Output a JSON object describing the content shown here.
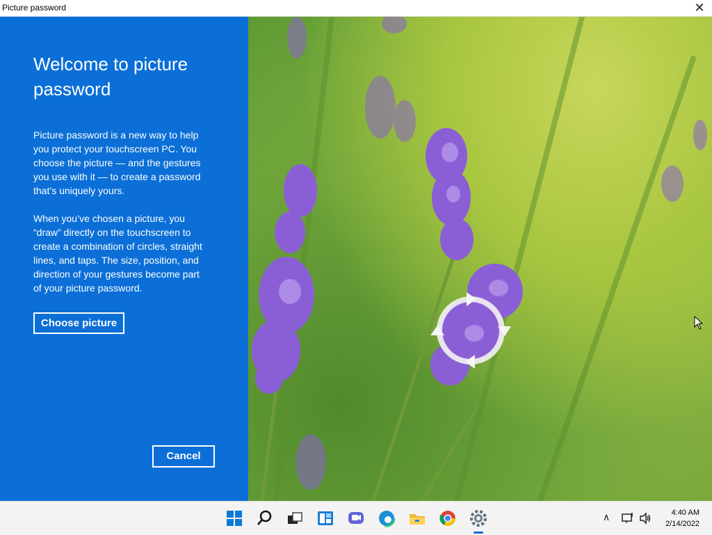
{
  "window": {
    "title": "Picture password",
    "close_label": "✕"
  },
  "panel": {
    "heading": "Welcome to picture password",
    "para1": "Picture password is a new way to help you protect your touchscreen PC. You choose the picture — and the gestures you use with it — to create a password that’s uniquely yours.",
    "para2": "When you’ve chosen a picture, you “draw” directly on the touchscreen to create a combination of circles, straight lines, and taps. The size, position, and direction of your gestures become part of your picture password.",
    "choose_button": "Choose picture",
    "cancel_button": "Cancel"
  },
  "taskbar": {
    "icons": [
      "windows-start-icon",
      "search-icon",
      "task-view-icon",
      "widgets-icon",
      "teams-chat-icon",
      "edge-icon",
      "file-explorer-icon",
      "chrome-icon",
      "settings-icon"
    ],
    "active_icon": "settings-icon",
    "time": "4:40 AM",
    "date": "2/14/2022"
  },
  "colors": {
    "panel_blue": "#0b6fd7",
    "taskbar": "#f3f3f3",
    "lavender": "#8a5fd6"
  }
}
